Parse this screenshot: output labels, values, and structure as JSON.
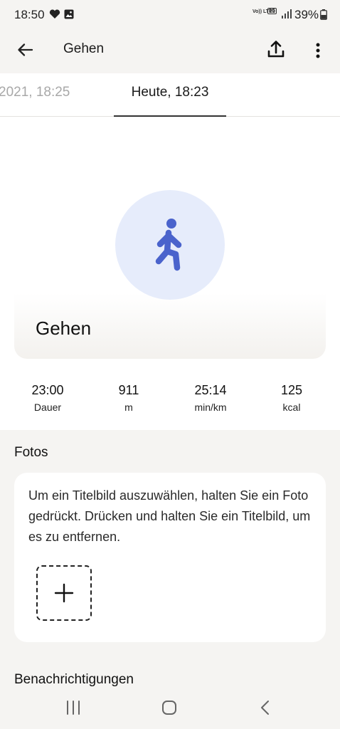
{
  "status_bar": {
    "time": "18:50",
    "network_volte": "Vo)) LTE1",
    "network_5g": "5G",
    "battery_percent": "39%",
    "icons": [
      "heart-icon",
      "gallery-icon",
      "signal-icon",
      "battery-icon"
    ]
  },
  "app_bar": {
    "title": "Gehen",
    "icons": [
      "back-arrow-icon",
      "share-icon",
      "more-vert-icon"
    ]
  },
  "tabs": {
    "previous": "2021, 18:25",
    "current": "Heute, 18:23"
  },
  "activity": {
    "name": "Gehen",
    "icon": "walking-person-icon",
    "icon_color": "#4a63cc",
    "circle_color": "#e6ecfb"
  },
  "stats": [
    {
      "value": "23:00",
      "unit": "Dauer"
    },
    {
      "value": "911",
      "unit": "m"
    },
    {
      "value": "25:14",
      "unit": "min/km"
    },
    {
      "value": "125",
      "unit": "kcal"
    }
  ],
  "fotos": {
    "title": "Fotos",
    "hint": "Um ein Titelbild auszuwählen, halten Sie ein Foto gedrückt. Drücken und halten Sie ein Titelbild, um es zu entfernen.",
    "add_icon": "plus-icon"
  },
  "notifications": {
    "title": "Benachrichtigungen"
  },
  "nav_bar": {
    "icons": [
      "recents-icon",
      "home-icon",
      "back-icon"
    ]
  }
}
